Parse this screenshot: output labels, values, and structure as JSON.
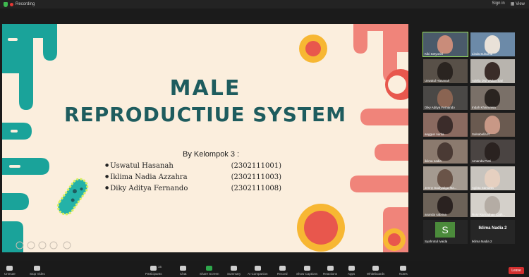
{
  "topbar": {
    "recording_label": "Recording",
    "sign_in": "Sign in",
    "view": "View"
  },
  "slide": {
    "title_line1": "MALE",
    "title_line2": "REPRODUCTIUE SYSTEM",
    "group_label": "By Kelompok 3 :",
    "members": [
      {
        "name": "Uswatul Hasanah",
        "id": "(2302111001)"
      },
      {
        "name": "Iklima Nadia Azzahra",
        "id": "(2302111003)"
      },
      {
        "name": "Diky Aditya Fernando",
        "id": "(2302111008)"
      }
    ]
  },
  "participants": [
    {
      "name": "Kiki Setyorini",
      "active": true
    },
    {
      "name": "Linda Suharna"
    },
    {
      "name": "Uswatul Hasanah"
    },
    {
      "name": "Adelia Dwi Wulan Sari"
    },
    {
      "name": "Diky Aditya Fernando"
    },
    {
      "name": "Indah Khairunisa"
    },
    {
      "name": "anggun nurita"
    },
    {
      "name": "Salsabella R"
    },
    {
      "name": "iklima nadia"
    },
    {
      "name": "Amanda Putri"
    },
    {
      "name": "Jenny Saulyatiga Ma..."
    },
    {
      "name": "Agista Samarta"
    },
    {
      "name": "ananda sabrina"
    },
    {
      "name": "Rory Ramadhan Cath..."
    },
    {
      "name": "Syahrotul Ivaida",
      "avatar": "S"
    },
    {
      "name": "Iklima Nadia 2",
      "big_name": "Iklima Nadia 2"
    }
  ],
  "toolbar": {
    "unmute": "Unmute",
    "stop_video": "Stop Video",
    "participants": "Participants",
    "participants_count": "16",
    "chat": "Chat",
    "share_screen": "Share Screen",
    "summary": "Summary",
    "ai_companion": "AI Companion",
    "record": "Record",
    "show_captions": "Show Captions",
    "reactions": "Reactions",
    "apps": "Apps",
    "whiteboards": "Whiteboards",
    "notes": "Notes",
    "leave": "Leave"
  },
  "colors": {
    "teal": "#1aa39a",
    "coral": "#f0847a",
    "title": "#1e5c5e",
    "slide_bg": "#fbeedd",
    "share_green": "#2ea84c",
    "leave_red": "#d32f2f"
  }
}
